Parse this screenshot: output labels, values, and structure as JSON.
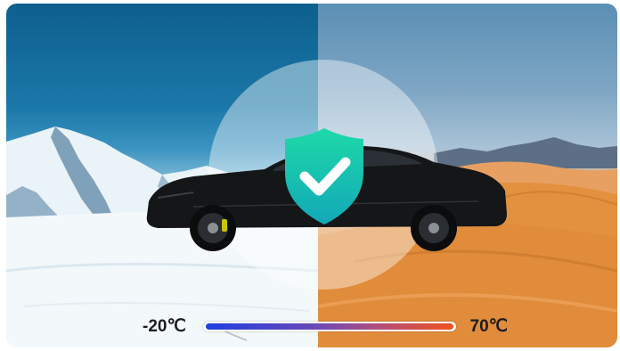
{
  "temperature": {
    "min_label": "-20℃",
    "max_label": "70℃",
    "fill_fraction": 1.0
  },
  "colors": {
    "winter_sky": "#0d5f8e",
    "desert_sand": "#e49852",
    "shield_top": "#1ed9a8",
    "shield_bottom": "#12a8b8",
    "bar_cold": "#1f3fe0",
    "bar_hot": "#f0521e"
  },
  "icons": {
    "shield": "shield-check-icon"
  }
}
